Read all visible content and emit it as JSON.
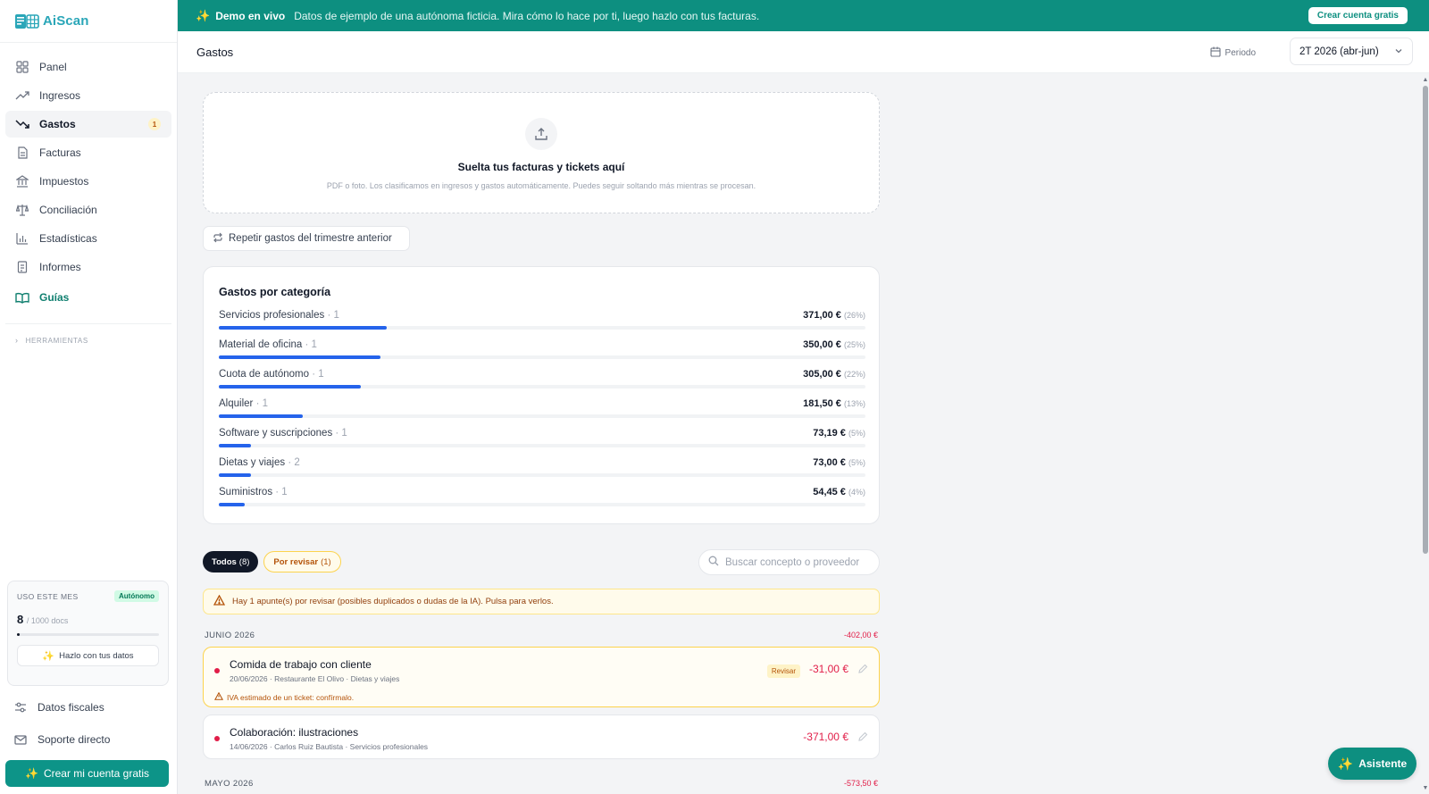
{
  "app": {
    "name": "AiScan"
  },
  "banner": {
    "title": "Demo en vivo",
    "text": "Datos de ejemplo de una autónoma ficticia. Mira cómo lo hace por ti, luego hazlo con tus facturas.",
    "button": "Crear cuenta gratis"
  },
  "sidebar": {
    "items": [
      {
        "label": "Panel",
        "icon": "grid-icon"
      },
      {
        "label": "Ingresos",
        "icon": "trending-up-icon"
      },
      {
        "label": "Gastos",
        "icon": "trending-down-icon",
        "badge": "1",
        "active": true
      },
      {
        "label": "Facturas",
        "icon": "document-icon"
      },
      {
        "label": "Impuestos",
        "icon": "bank-icon"
      },
      {
        "label": "Conciliación",
        "icon": "scale-icon"
      },
      {
        "label": "Estadísticas",
        "icon": "bar-chart-icon"
      },
      {
        "label": "Informes",
        "icon": "report-icon"
      }
    ],
    "guias": "Guías",
    "tools": "HERRAMIENTAS",
    "usage": {
      "title": "USO ESTE MES",
      "plan": "Autónomo",
      "count": "8",
      "total": "/ 1000 docs",
      "fraction": 0.008,
      "button": "Hazlo con tus datos"
    },
    "fiscal": "Datos fiscales",
    "support": "Soporte directo",
    "create": "Crear mi cuenta gratis"
  },
  "header": {
    "title": "Gastos",
    "period_label": "Periodo",
    "period_value": "2T 2026 (abr-jun)"
  },
  "dropzone": {
    "title": "Suelta tus facturas y tickets aquí",
    "subtitle": "PDF o foto. Los clasificamos en ingresos y gastos automáticamente. Puedes seguir soltando más mientras se procesan."
  },
  "repeat_button": "Repetir gastos del trimestre anterior",
  "categories": {
    "title": "Gastos por categoría",
    "rows": [
      {
        "name": "Servicios profesionales",
        "count": "· 1",
        "amount": "371,00 €",
        "pct": "(26%)",
        "share": 0.26
      },
      {
        "name": "Material de oficina",
        "count": "· 1",
        "amount": "350,00 €",
        "pct": "(25%)",
        "share": 0.25
      },
      {
        "name": "Cuota de autónomo",
        "count": "· 1",
        "amount": "305,00 €",
        "pct": "(22%)",
        "share": 0.22
      },
      {
        "name": "Alquiler",
        "count": "· 1",
        "amount": "181,50 €",
        "pct": "(13%)",
        "share": 0.13
      },
      {
        "name": "Software y suscripciones",
        "count": "· 1",
        "amount": "73,19 €",
        "pct": "(5%)",
        "share": 0.05
      },
      {
        "name": "Dietas y viajes",
        "count": "· 2",
        "amount": "73,00 €",
        "pct": "(5%)",
        "share": 0.05
      },
      {
        "name": "Suministros",
        "count": "· 1",
        "amount": "54,45 €",
        "pct": "(4%)",
        "share": 0.04
      }
    ]
  },
  "filters": {
    "all": "Todos",
    "all_count": "(8)",
    "review": "Por revisar",
    "review_count": "(1)",
    "search_placeholder": "Buscar concepto o proveedor"
  },
  "alert": "Hay 1 apunte(s) por revisar (posibles duplicados o dudas de la IA). Pulsa para verlos.",
  "months": [
    {
      "label": "JUNIO 2026",
      "total": "-402,00 €",
      "items": [
        {
          "title": "Comida de trabajo con cliente",
          "sub": "20/06/2026 · Restaurante El Olivo · Dietas y viajes",
          "badge": "Revisar",
          "amount": "-31,00 €",
          "note": "IVA estimado de un ticket: confírmalo."
        },
        {
          "title": "Colaboración: ilustraciones",
          "sub": "14/06/2026 · Carlos Ruiz Bautista · Servicios profesionales",
          "amount": "-371,00 €"
        }
      ]
    },
    {
      "label": "MAYO 2026",
      "total": "-573,50 €"
    }
  ],
  "assistant": "Asistente"
}
